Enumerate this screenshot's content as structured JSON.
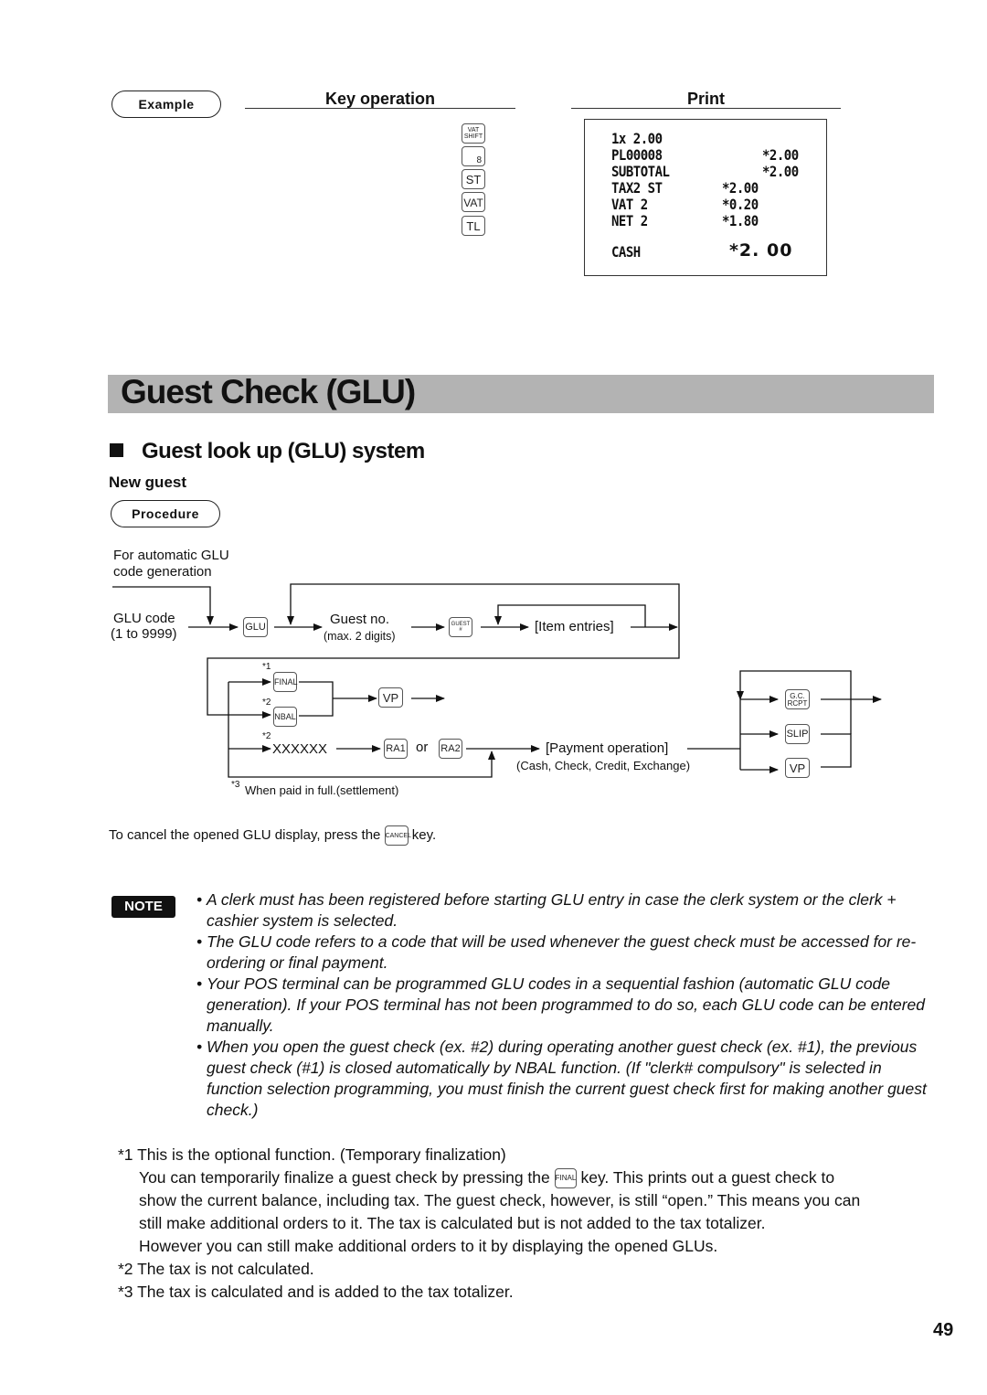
{
  "example_section": {
    "example_label": "Example",
    "key_operation_header": "Key operation",
    "print_header": "Print",
    "keys": [
      {
        "id": "vat-shift",
        "label_line1": "VAT",
        "label_line2": "SHIFT"
      },
      {
        "id": "digit-8",
        "label": "8"
      },
      {
        "id": "st",
        "label": "ST"
      },
      {
        "id": "vat",
        "label": "VAT"
      },
      {
        "id": "tl",
        "label": "TL"
      }
    ],
    "receipt": {
      "lines": [
        {
          "left": "1x 2.00",
          "right": ""
        },
        {
          "left": "PL00008",
          "right": "*2.00"
        },
        {
          "left": "SUBTOTAL",
          "right": "*2.00"
        },
        {
          "left": "TAX2 ST",
          "right": "*2.00"
        },
        {
          "left": "VAT 2",
          "right": "*0.20"
        },
        {
          "left": "NET 2",
          "right": "*1.80"
        }
      ],
      "total_label": "CASH",
      "total_value": "*2. 00"
    }
  },
  "section": {
    "title": "Guest Check (GLU)",
    "subtitle": "Guest look up (GLU) system",
    "subheading": "New guest",
    "procedure_label": "Procedure"
  },
  "flow": {
    "auto_gen_line1": "For automatic GLU",
    "auto_gen_line2": "code generation",
    "glu_code_line1": "GLU code",
    "glu_code_line2": "(1 to 9999)",
    "key_glu": "GLU",
    "guest_no": "Guest no.",
    "guest_no_note": "(max. 2 digits)",
    "key_guest_line1": "GUEST",
    "key_guest_line2": "#",
    "item_entries": "[Item entries]",
    "mark1": "*1",
    "mark2a": "*2",
    "mark2b": "*2",
    "mark3": "*3",
    "key_final": "FINAL",
    "key_nbal": "NBAL",
    "key_vp": "VP",
    "xxxxxx": "XXXXXX",
    "key_ra1": "RA1",
    "or_text": "or",
    "key_ra2": "RA2",
    "payment_operation": "[Payment operation]",
    "payment_types": "(Cash, Check, Credit, Exchange)",
    "settlement_note": "When paid in full.(settlement)",
    "key_gc_line1": "G.C.",
    "key_gc_line2": "RCPT",
    "key_slip": "SLIP",
    "key_vp2": "VP"
  },
  "cancel_text": {
    "before": "To cancel the opened GLU display, press the",
    "key": "CANCEL",
    "after": "key."
  },
  "note": {
    "badge": "NOTE",
    "items": [
      "A clerk must has been registered before starting GLU entry in case the clerk system or the clerk + cashier system is selected.",
      "The GLU code refers to a code that will be used whenever the guest check must be accessed for re-ordering or final payment.",
      "Your POS terminal can be programmed GLU codes in a sequential fashion (automatic GLU code generation).  If your POS terminal has not been programmed to do so, each GLU code can be entered manually.",
      "When you open the guest check (ex. #2) during operating another guest check (ex. #1), the previous guest check (#1) is closed automatically by NBAL function. (If \"clerk# compulsory\" is selected in function selection programming, you must finish the current guest check first for making another guest check.)"
    ]
  },
  "footnotes": {
    "fn1_title": "*1 This is the optional function. (Temporary finalization)",
    "fn1_before_key": "You can temporarily finalize a guest check by pressing the",
    "fn1_key": "FINAL",
    "fn1_after_key": "key.  This prints out a guest check to",
    "fn1_line3": "show the current balance, including tax.  The guest check,  however, is still “open.”  This means you can",
    "fn1_line4": "still make additional orders to it.  The tax is calculated but is not added to the tax totalizer.",
    "fn1_line5": "However you can still make additional orders to it by displaying the opened GLUs.",
    "fn2": "*2 The tax is not calculated.",
    "fn3": "*3 The tax is calculated and is added to the tax totalizer."
  },
  "page_number": "49"
}
